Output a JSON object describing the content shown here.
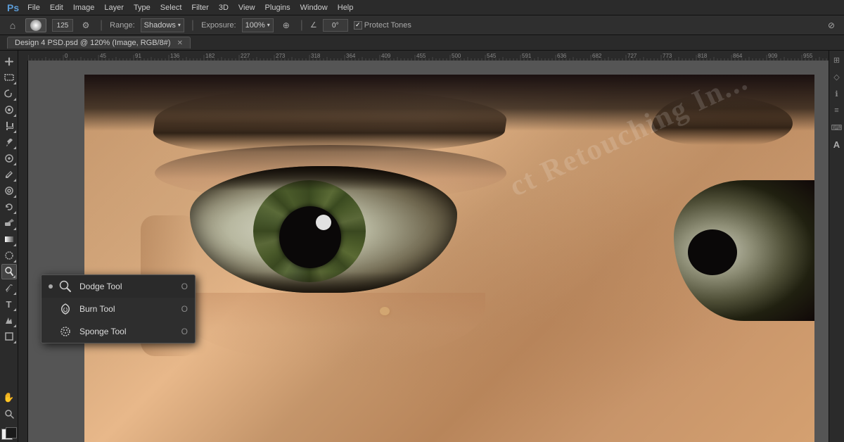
{
  "app": {
    "title": "Adobe Photoshop"
  },
  "menubar": {
    "items": [
      "PS",
      "File",
      "Edit",
      "Image",
      "Layer",
      "Type",
      "Select",
      "Filter",
      "3D",
      "View",
      "Plugins",
      "Window",
      "Help"
    ]
  },
  "optionsbar": {
    "range_label": "Range:",
    "range_value": "Shadows",
    "exposure_label": "Exposure:",
    "exposure_value": "100%",
    "angle_label": "∠",
    "angle_value": "0°",
    "protect_tones_label": "Protect Tones",
    "size_value": "125"
  },
  "doctab": {
    "label": "Design 4 PSD.psd @ 120% (Image, RGB/8#)"
  },
  "toolbar": {
    "tools": [
      {
        "name": "move",
        "icon": "✛",
        "has_submenu": false
      },
      {
        "name": "select-rect",
        "icon": "▭",
        "has_submenu": true
      },
      {
        "name": "lasso",
        "icon": "⬭",
        "has_submenu": true
      },
      {
        "name": "quick-select",
        "icon": "◈",
        "has_submenu": true
      },
      {
        "name": "crop",
        "icon": "⊡",
        "has_submenu": true
      },
      {
        "name": "eyedropper",
        "icon": "⌇",
        "has_submenu": true
      },
      {
        "name": "spot-heal",
        "icon": "⊕",
        "has_submenu": true
      },
      {
        "name": "brush",
        "icon": "✏",
        "has_submenu": true
      },
      {
        "name": "clone-stamp",
        "icon": "⊛",
        "has_submenu": true
      },
      {
        "name": "history-brush",
        "icon": "↺",
        "has_submenu": true
      },
      {
        "name": "eraser",
        "icon": "◻",
        "has_submenu": true
      },
      {
        "name": "gradient",
        "icon": "▦",
        "has_submenu": true
      },
      {
        "name": "blur",
        "icon": "◌",
        "has_submenu": true
      },
      {
        "name": "dodge",
        "icon": "⊙",
        "has_submenu": true,
        "active": true
      },
      {
        "name": "pen",
        "icon": "✒",
        "has_submenu": true
      },
      {
        "name": "type",
        "icon": "T",
        "has_submenu": true
      },
      {
        "name": "path-select",
        "icon": "↗",
        "has_submenu": true
      },
      {
        "name": "shape",
        "icon": "□",
        "has_submenu": true
      },
      {
        "name": "hand",
        "icon": "✋",
        "has_submenu": false
      },
      {
        "name": "zoom",
        "icon": "⊕",
        "has_submenu": false
      }
    ]
  },
  "context_menu": {
    "items": [
      {
        "id": "dodge",
        "label": "Dodge Tool",
        "shortcut": "O",
        "icon_type": "dodge",
        "selected": true
      },
      {
        "id": "burn",
        "label": "Burn Tool",
        "shortcut": "O",
        "icon_type": "burn",
        "selected": false
      },
      {
        "id": "sponge",
        "label": "Sponge Tool",
        "shortcut": "O",
        "icon_type": "sponge",
        "selected": false
      }
    ]
  },
  "canvas": {
    "watermark": "ct Retouching In...",
    "zoom_level": "120%"
  },
  "right_panel": {
    "icons": [
      "⊞",
      "♦",
      "ℹ",
      "≡",
      "⌨",
      "A"
    ]
  }
}
